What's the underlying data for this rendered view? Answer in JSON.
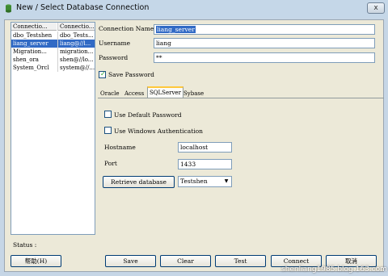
{
  "window": {
    "title": "New / Select Database Connection",
    "close_label": "x"
  },
  "connections": {
    "headers": [
      "Connectio...",
      "Connectio..."
    ],
    "rows": [
      {
        "name": "dbo_Testshen",
        "conn": "dbo_Tests..."
      },
      {
        "name": "liang_server",
        "conn": "liang@//l..."
      },
      {
        "name": "Migration...",
        "conn": "migration..."
      },
      {
        "name": "shen_ora",
        "conn": "shen@//lo..."
      },
      {
        "name": "System_Orcl",
        "conn": "system@//..."
      }
    ]
  },
  "form": {
    "connection_name_label": "Connection Name",
    "connection_name_value": "liang_server",
    "username_label": "Username",
    "username_value": "liang",
    "password_label": "Password",
    "password_value": "**",
    "save_password_label": "Save Password"
  },
  "tabs": [
    "Oracle",
    "Access",
    "SQLServer",
    "Sybase"
  ],
  "sqlserver": {
    "use_default_password_label": "Use Default Password",
    "use_windows_auth_label": "Use Windows Authentication",
    "hostname_label": "Hostname",
    "hostname_value": "localhost",
    "port_label": "Port",
    "port_value": "1433",
    "retrieve_label": "Retrieve database",
    "database_value": "Testshen"
  },
  "status_label": "Status :",
  "buttons": {
    "help": "帮助(H)",
    "save": "Save",
    "clear": "Clear",
    "test": "Test",
    "connect": "Connect",
    "cancel": "取消"
  },
  "watermark": "shenliang1985.blog.163.com"
}
